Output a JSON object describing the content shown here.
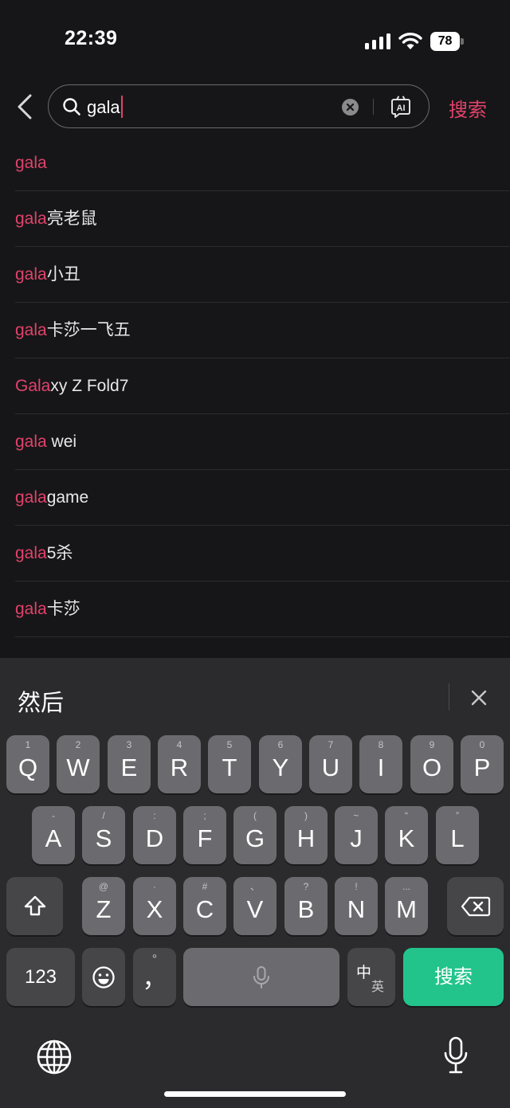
{
  "status_bar": {
    "time": "22:39",
    "battery": "78"
  },
  "search": {
    "query": "gala",
    "submit_label": "搜索",
    "ai_label": "AI"
  },
  "suggestions": [
    {
      "hl": "gala",
      "rest": ""
    },
    {
      "hl": "gala",
      "rest": "亮老鼠"
    },
    {
      "hl": "gala",
      "rest": "小丑"
    },
    {
      "hl": "gala",
      "rest": "卡莎一飞五"
    },
    {
      "hl": "Gala",
      "rest": "xy Z Fold7"
    },
    {
      "hl": "gala",
      "rest": " wei"
    },
    {
      "hl": "gala",
      "rest": "game"
    },
    {
      "hl": "gala",
      "rest": "5杀"
    },
    {
      "hl": "gala",
      "rest": "卡莎"
    }
  ],
  "keyboard": {
    "candidate": "然后",
    "row1": [
      {
        "k": "Q",
        "s": "1"
      },
      {
        "k": "W",
        "s": "2"
      },
      {
        "k": "E",
        "s": "3"
      },
      {
        "k": "R",
        "s": "4"
      },
      {
        "k": "T",
        "s": "5"
      },
      {
        "k": "Y",
        "s": "6"
      },
      {
        "k": "U",
        "s": "7"
      },
      {
        "k": "I",
        "s": "8"
      },
      {
        "k": "O",
        "s": "9"
      },
      {
        "k": "P",
        "s": "0"
      }
    ],
    "row2": [
      {
        "k": "A",
        "s": "-"
      },
      {
        "k": "S",
        "s": "/"
      },
      {
        "k": "D",
        "s": ":"
      },
      {
        "k": "F",
        "s": ";"
      },
      {
        "k": "G",
        "s": "("
      },
      {
        "k": "H",
        "s": ")"
      },
      {
        "k": "J",
        "s": "~"
      },
      {
        "k": "K",
        "s": "“"
      },
      {
        "k": "L",
        "s": "”"
      }
    ],
    "row3": [
      {
        "k": "Z",
        "s": "@"
      },
      {
        "k": "X",
        "s": "·"
      },
      {
        "k": "C",
        "s": "#"
      },
      {
        "k": "V",
        "s": "、"
      },
      {
        "k": "B",
        "s": "?"
      },
      {
        "k": "N",
        "s": "!"
      },
      {
        "k": "M",
        "s": "..."
      }
    ],
    "numbers_label": "123",
    "comma_top": "°",
    "comma": "，",
    "lang_top": "中",
    "lang_bottom": "英",
    "enter_label": "搜索"
  },
  "colors": {
    "accent": "#e2426b",
    "enter_key": "#22c48c",
    "background": "#161618"
  }
}
